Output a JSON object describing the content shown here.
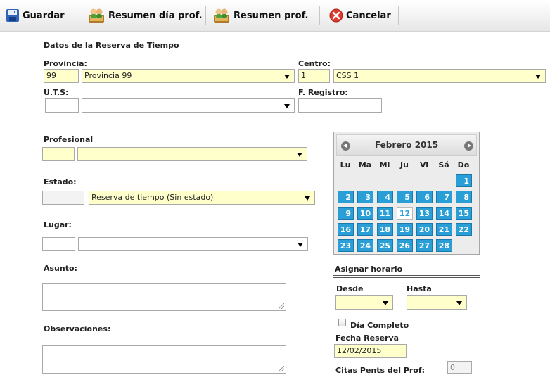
{
  "toolbar": {
    "save_label": "Guardar",
    "summary_day_label": "Resumen día prof.",
    "summary_label": "Resumen prof.",
    "cancel_label": "Cancelar"
  },
  "section_title": "Datos de la Reserva de Tiempo",
  "form": {
    "provincia_label": "Provincia:",
    "provincia_code": "99",
    "provincia_value": "Provincia 99",
    "centro_label": "Centro:",
    "centro_code": "1",
    "centro_value": "CSS 1",
    "uts_label": "U.T.S:",
    "uts_code": "",
    "uts_value": "",
    "fregistro_label": "F. Registro:",
    "fregistro_value": "",
    "profesional_label": "Profesional",
    "profesional_code": "",
    "profesional_value": "",
    "estado_label": "Estado:",
    "estado_code": "",
    "estado_value": "Reserva de tiempo (Sin estado)",
    "lugar_label": "Lugar:",
    "lugar_code": "",
    "lugar_value": "",
    "asunto_label": "Asunto:",
    "observaciones_label": "Observaciones:"
  },
  "calendar": {
    "title": "Febrero 2015",
    "weekdays": [
      "Lu",
      "Ma",
      "Mi",
      "Ju",
      "Vi",
      "Sá",
      "Do"
    ],
    "today": "12",
    "days": [
      "1",
      "2",
      "3",
      "4",
      "5",
      "6",
      "7",
      "8",
      "9",
      "10",
      "11",
      "12",
      "13",
      "14",
      "15",
      "16",
      "17",
      "18",
      "19",
      "20",
      "21",
      "22",
      "23",
      "24",
      "25",
      "26",
      "27",
      "28"
    ]
  },
  "horario": {
    "title": "Asignar horario",
    "desde_label": "Desde",
    "desde_value": "",
    "hasta_label": "Hasta",
    "hasta_value": "",
    "dia_completo_label": "Día Completo",
    "fecha_reserva_label": "Fecha Reserva",
    "fecha_reserva_value": "12/02/2015",
    "citas_label": "Citas Pents del Prof:",
    "citas_value": "0"
  },
  "colors": {
    "field_highlight": "#ffffcc",
    "calendar_day": "#2a9ed6"
  },
  "icons": {
    "save": "floppy-disk-icon",
    "summary_day": "users-report-icon",
    "summary": "users-report-icon",
    "cancel": "cancel-icon"
  }
}
